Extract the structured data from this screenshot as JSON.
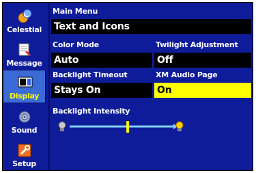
{
  "sidebar": {
    "items": [
      {
        "label": "Celestial",
        "icon": "celestial-icon"
      },
      {
        "label": "Message",
        "icon": "message-icon"
      },
      {
        "label": "Display",
        "icon": "display-icon",
        "active": true
      },
      {
        "label": "Sound",
        "icon": "sound-icon"
      },
      {
        "label": "Setup",
        "icon": "setup-icon"
      }
    ]
  },
  "main_menu": {
    "label": "Main Menu",
    "value": "Text and Icons"
  },
  "color_mode": {
    "label": "Color Mode",
    "value": "Auto"
  },
  "twilight": {
    "label": "Twilight Adjustment",
    "value": "Off"
  },
  "backlight_timeout": {
    "label": "Backlight Timeout",
    "value": "Stays On"
  },
  "xm_audio": {
    "label": "XM Audio Page",
    "value": "On"
  },
  "backlight_intensity": {
    "label": "Backlight Intensity",
    "level": 0.56
  },
  "colors": {
    "background": "#0f1c99",
    "field": "#000000",
    "selected": "#ffff00",
    "active_tab": "#3a6bd6"
  }
}
